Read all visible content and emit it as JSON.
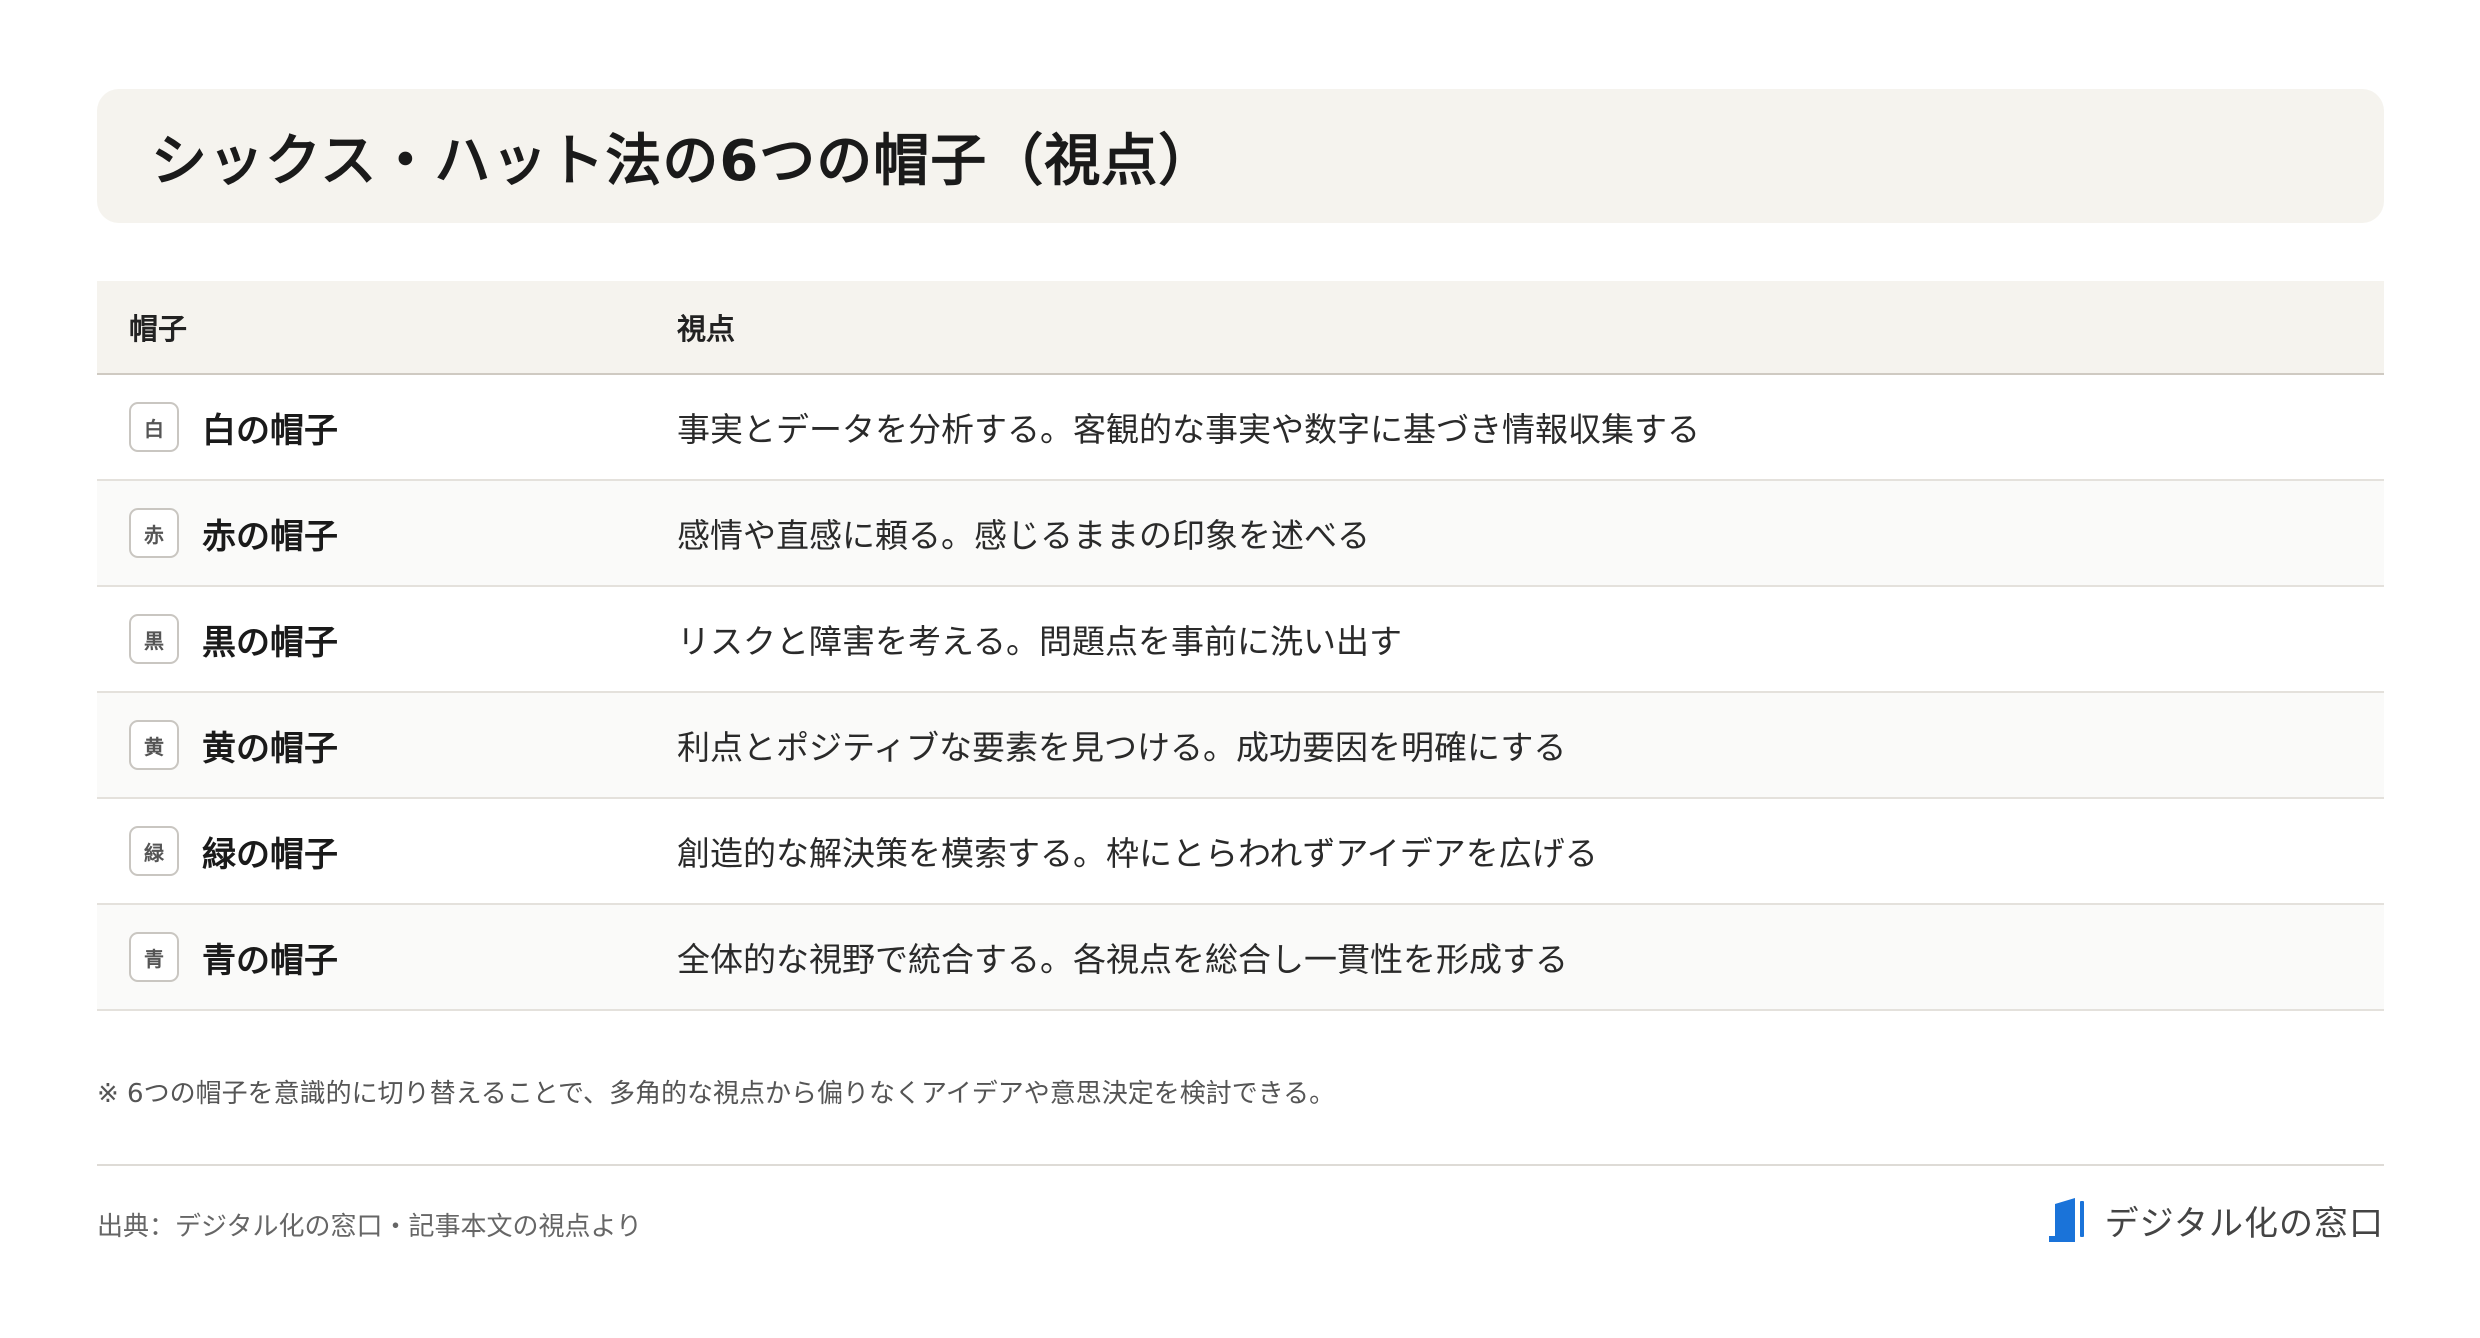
{
  "title": "シックス・ハット法の6つの帽子（視点）",
  "table": {
    "headers": {
      "hat": "帽子",
      "view": "視点"
    },
    "rows": [
      {
        "badge": "白",
        "name": "白の帽子",
        "view": "事実とデータを分析する。客観的な事実や数字に基づき情報収集する"
      },
      {
        "badge": "赤",
        "name": "赤の帽子",
        "view": "感情や直感に頼る。感じるままの印象を述べる"
      },
      {
        "badge": "黒",
        "name": "黒の帽子",
        "view": "リスクと障害を考える。問題点を事前に洗い出す"
      },
      {
        "badge": "黄",
        "name": "黄の帽子",
        "view": "利点とポジティブな要素を見つける。成功要因を明確にする"
      },
      {
        "badge": "緑",
        "name": "緑の帽子",
        "view": "創造的な解決策を模索する。枠にとらわれずアイデアを広げる"
      },
      {
        "badge": "青",
        "name": "青の帽子",
        "view": "全体的な視野で統合する。各視点を総合し一貫性を形成する"
      }
    ]
  },
  "note": "※ 6つの帽子を意識的に切り替えることで、多角的な視点から偏りなくアイデアや意思決定を検討できる。",
  "footer": {
    "source": "出典：デジタル化の窓口・記事本文の視点より",
    "brand_name": "デジタル化の窓口",
    "brand_icon": "book-logo-icon"
  },
  "colors": {
    "title_bg": "#f5f3ee",
    "header_bg": "#f5f3ee",
    "brand_blue": "#1a73d9"
  }
}
